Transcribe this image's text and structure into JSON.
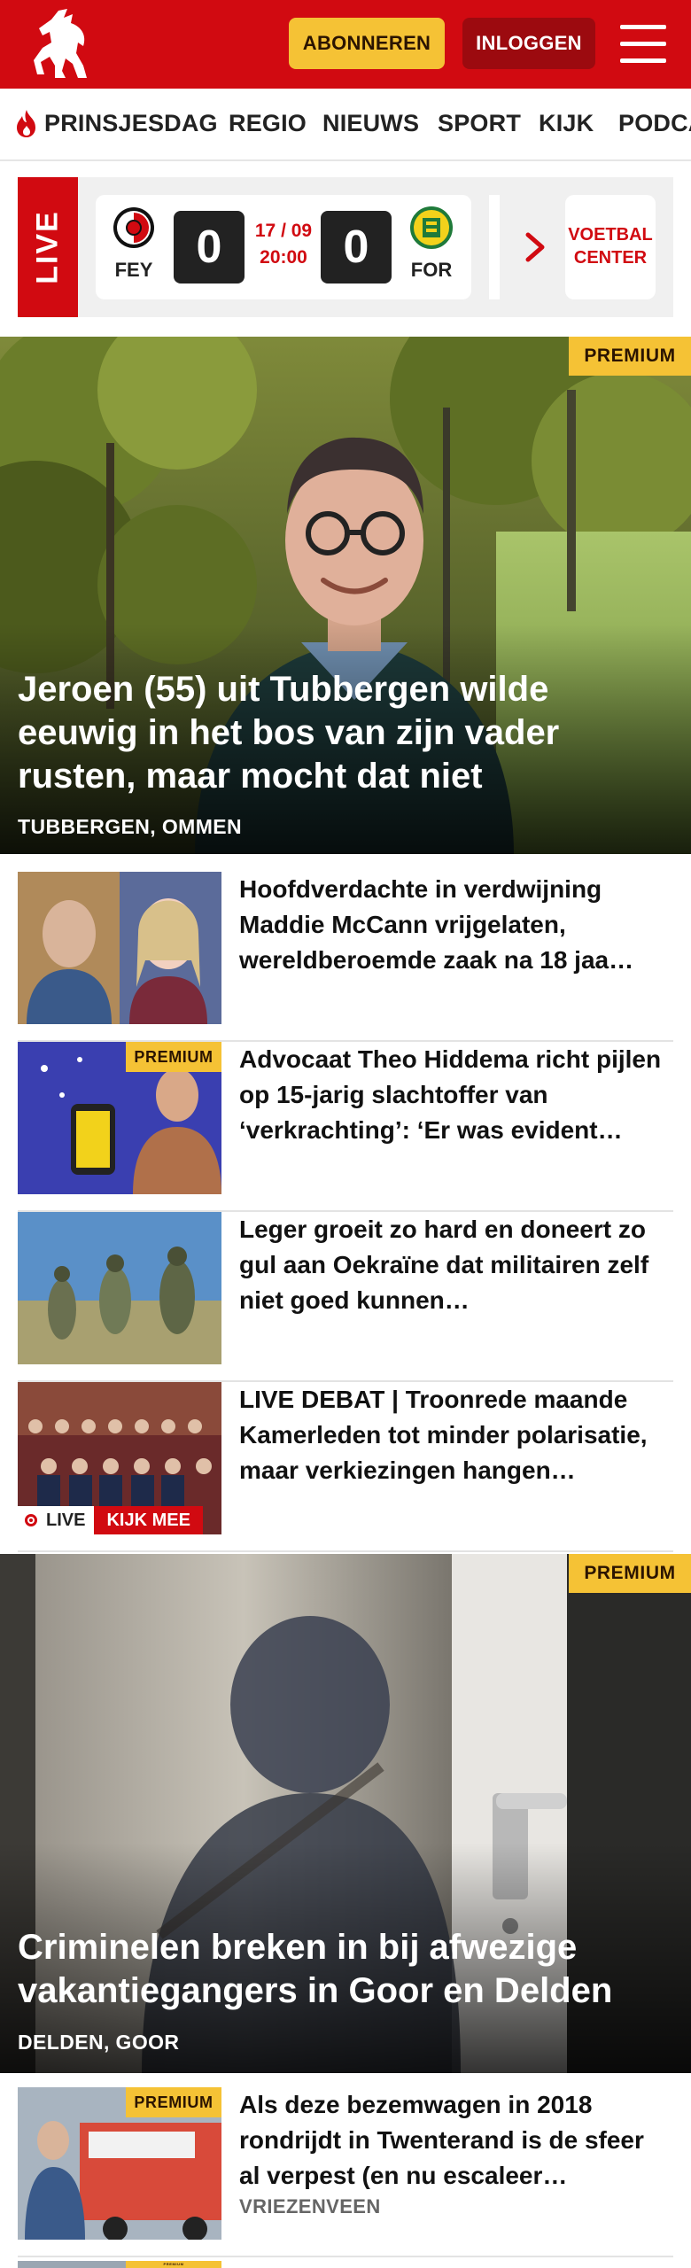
{
  "header": {
    "subscribe_label": "ABONNEREN",
    "login_label": "INLOGGEN",
    "brand_color": "#d10a11",
    "accent_color": "#f5c235"
  },
  "nav": {
    "items": [
      "PRINSJESDAG",
      "REGIO",
      "NIEUWS",
      "SPORT",
      "KIJK",
      "PODCA"
    ]
  },
  "live": {
    "tag": "LIVE",
    "home_team": "FEY",
    "away_team": "FOR",
    "home_score": "0",
    "away_score": "0",
    "date": "17 / 09",
    "time": "20:00",
    "center_line1": "VOETBAL",
    "center_line2": "CENTER"
  },
  "hero1": {
    "badge": "PREMIUM",
    "title": "Jeroen (55) uit Tubbergen wilde eeuwig in het bos van zijn vader rusten, maar mocht dat niet",
    "location": "TUBBERGEN, OMMEN"
  },
  "articles": [
    {
      "title": "Hoofdverdachte in verdwijning Maddie McCann vrijgelaten, wereldberoemde zaak na 18 jaa…",
      "badge": "",
      "sub": ""
    },
    {
      "title": "Advocaat Theo Hiddema richt pijlen op 15-jarig slachtoffer van ‘verkrachting’: ‘Er was evident…",
      "badge": "PREMIUM",
      "sub": ""
    },
    {
      "title": "Leger groeit zo hard en doneert zo gul aan Oekraïne dat militairen zelf niet goed kunnen…",
      "badge": "",
      "sub": ""
    },
    {
      "title": "LIVE DEBAT | Troonrede maande Kamerleden tot minder polarisa­tie, maar verkiezingen hangen…",
      "badge": "",
      "sub": "",
      "live_label": "LIVE",
      "watch_label": "KIJK MEE"
    }
  ],
  "hero2": {
    "badge": "PREMIUM",
    "title": "Criminelen breken in bij afwezige vakantiegangers in Goor en Delden",
    "location": "DELDEN, GOOR"
  },
  "articles2": [
    {
      "title": "Als deze bezemwagen in 2018 rondrijdt in Twenterand is de sfeer al verpest (en nu escaleer…",
      "badge": "PREMIUM",
      "sub": "VRIEZENVEEN"
    }
  ],
  "partial": {
    "badge": "PREMIUM"
  }
}
